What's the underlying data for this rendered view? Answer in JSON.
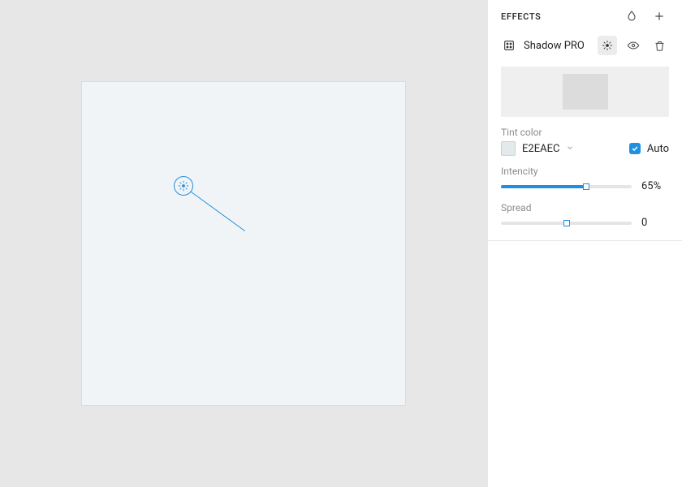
{
  "panel": {
    "title": "EFFECTS",
    "effect_name": "Shadow PRO"
  },
  "tint": {
    "label": "Tint color",
    "value": "E2EAEC",
    "swatch_color": "#E2EAEC",
    "auto_checked": true,
    "auto_label": "Auto"
  },
  "intensity": {
    "label": "Intencity",
    "value": 65,
    "display": "65%"
  },
  "spread": {
    "label": "Spread",
    "value": 0,
    "display": "0",
    "thumb_pct": 50
  },
  "accent": "#1E8FE1"
}
